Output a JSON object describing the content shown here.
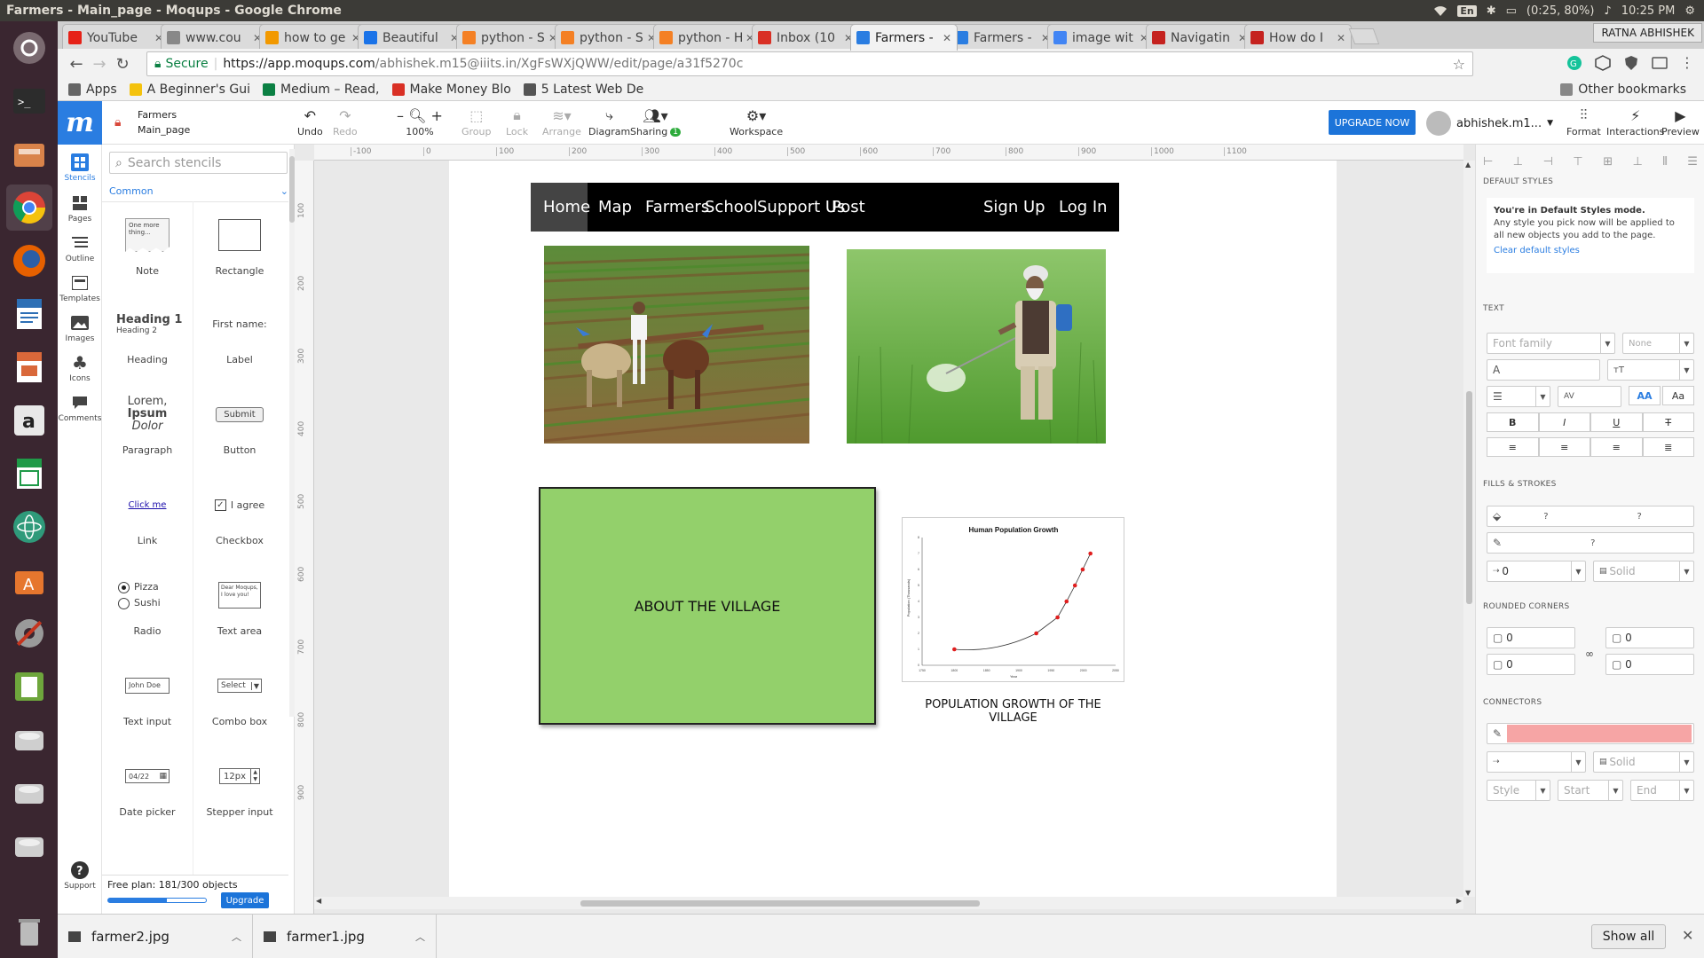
{
  "os": {
    "window_title": "Farmers - Main_page - Moqups - Google Chrome",
    "keyboard_layout": "En",
    "battery": "(0:25, 80%)",
    "clock": "10:25 PM"
  },
  "chrome": {
    "user_name": "RATNA ABHISHEK",
    "tabs": [
      {
        "label": "YouTube",
        "color": "#e62117"
      },
      {
        "label": "www.cou",
        "color": "#888888"
      },
      {
        "label": "how to ge",
        "color": "#f29900"
      },
      {
        "label": "Beautiful",
        "color": "#1a73e8"
      },
      {
        "label": "python - S",
        "color": "#f48024"
      },
      {
        "label": "python - S",
        "color": "#f48024"
      },
      {
        "label": "python - H",
        "color": "#f48024"
      },
      {
        "label": "Inbox (10",
        "color": "#d93025"
      },
      {
        "label": "Farmers -",
        "color": "#2a7de1"
      },
      {
        "label": "Farmers -",
        "color": "#2a7de1"
      },
      {
        "label": "image wit",
        "color": "#4285f4"
      },
      {
        "label": "Navigatin",
        "color": "#c5221f"
      },
      {
        "label": "How do I",
        "color": "#c5221f"
      }
    ],
    "secure_label": "Secure",
    "url_host": "https://app.moqups.com",
    "url_path": "/abhishek.m15@iiits.in/XgFsWXjQWW/edit/page/a31f5270c",
    "bookmarks": [
      {
        "label": "Apps",
        "color": "#666666"
      },
      {
        "label": "A Beginner's Gui",
        "color": "#f4c20d"
      },
      {
        "label": "Medium – Read,",
        "color": "#0b8043"
      },
      {
        "label": "Make Money Blo",
        "color": "#d93025"
      },
      {
        "label": "5 Latest Web De",
        "color": "#555555"
      }
    ],
    "other_bookmarks": "Other bookmarks"
  },
  "app": {
    "project": "Farmers",
    "page": "Main_page",
    "toolbar": {
      "undo": "Undo",
      "redo": "Redo",
      "zoom": "100%",
      "group": "Group",
      "lock": "Lock",
      "arrange": "Arrange",
      "diagram": "Diagram",
      "sharing": "Sharing",
      "sharing_count": "1",
      "workspace": "Workspace",
      "upgrade": "UPGRADE NOW",
      "user": "abhishek.m1...",
      "format": "Format",
      "interactions": "Interactions",
      "preview": "Preview"
    },
    "rail": {
      "stencils": "Stencils",
      "pages": "Pages",
      "outline": "Outline",
      "templates": "Templates",
      "images": "Images",
      "icons": "Icons",
      "comments": "Comments",
      "support": "Support"
    },
    "stencils": {
      "search_placeholder": "Search stencils",
      "category": "Common",
      "note_text": "One more thing...",
      "heading1": "Heading 1",
      "heading2": "Heading 2",
      "label_text": "First name:",
      "lorem": [
        "Lorem,",
        "Ipsum",
        "Dolor"
      ],
      "submit": "Submit",
      "link": "Click me",
      "checkbox": "I agree",
      "radio1": "Pizza",
      "radio2": "Sushi",
      "textarea": "Dear Moqups, I love you!",
      "textinput": "John Doe",
      "combo": "Select",
      "date": "04/22",
      "stepper": "12px",
      "items": [
        "Note",
        "Rectangle",
        "Heading",
        "Label",
        "Paragraph",
        "Button",
        "Link",
        "Checkbox",
        "Radio",
        "Text area",
        "Text input",
        "Combo box",
        "Date picker",
        "Stepper input"
      ]
    },
    "plan": {
      "text": "Free plan: 181/300 objects",
      "used_fraction": 0.6033,
      "upgrade": "Upgrade"
    },
    "ruler": {
      "h": [
        "-100",
        "0",
        "100",
        "200",
        "300",
        "400",
        "500",
        "600",
        "700",
        "800",
        "900",
        "1000",
        "1100"
      ],
      "v": [
        "100",
        "200",
        "300",
        "400",
        "500",
        "600",
        "700",
        "800",
        "900"
      ]
    }
  },
  "mockup": {
    "nav": [
      "Home",
      "Map",
      "Farmers",
      "School",
      "Support Us",
      "Post"
    ],
    "nav_right": [
      "Sign Up",
      "Log In"
    ],
    "village_box": "ABOUT THE VILLAGE",
    "box_color": "#93d06b",
    "caption": "POPULATION GROWTH OF THE VILLAGE"
  },
  "chart_data": {
    "type": "line",
    "title": "Human Population Growth",
    "xlabel": "Year",
    "ylabel": "Population (Thousands)",
    "xlim": [
      1750,
      2050
    ],
    "ylim": [
      0,
      8
    ],
    "x_ticks": [
      "1750",
      "1800",
      "1850",
      "1900",
      "1950",
      "2000",
      "2050"
    ],
    "y_ticks": [
      "0",
      "1",
      "2",
      "3",
      "4",
      "5",
      "6",
      "7",
      "8"
    ],
    "series": [
      {
        "x": [
          1800,
          1927,
          1960,
          1974,
          1987,
          1999,
          2011
        ],
        "y": [
          1,
          2,
          3,
          4,
          5,
          6,
          7
        ]
      }
    ]
  },
  "right_panel": {
    "default_styles": "DEFAULT STYLES",
    "default_title": "You're in Default Styles mode.",
    "default_body": "Any style you pick now will be applied to all new objects you add to the page.",
    "clear": "Clear default styles",
    "text": "TEXT",
    "font_family": "Font family",
    "none": "None",
    "fills": "FILLS & STROKES",
    "q": "?",
    "zero": "0",
    "solid": "Solid",
    "rounded": "ROUNDED CORNERS",
    "connectors": "CONNECTORS",
    "style": "Style",
    "start": "Start",
    "end": "End",
    "connector_color": "#f6a5a5"
  },
  "downloads": {
    "files": [
      "farmer2.jpg",
      "farmer1.jpg"
    ],
    "show_all": "Show all"
  }
}
